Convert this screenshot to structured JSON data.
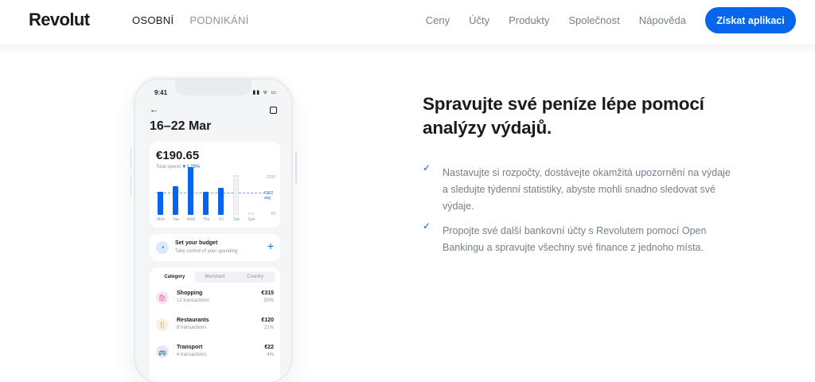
{
  "nav": {
    "logo": "Revolut",
    "left_items": [
      "OSOBNÍ",
      "PODNIKÁNÍ"
    ],
    "right_items": [
      "Ceny",
      "Účty",
      "Produkty",
      "Společnost",
      "Nápověda"
    ],
    "cta": "Získat aplikaci"
  },
  "phone": {
    "time": "9:41",
    "status_icons": "▮▮ ᯤ ▭",
    "back_icon": "arrow-left-icon",
    "date_range": "16–22 Mar",
    "spend": {
      "amount": "€190.65",
      "label": "Total spend",
      "change": "▼1.25%",
      "y_labels": [
        "€200",
        "€102 avg",
        "€0"
      ],
      "days": [
        "Mon",
        "Tue",
        "Wed",
        "Thu",
        "Fri",
        "Sat",
        "Sun"
      ],
      "values": [
        72,
        90,
        148,
        72,
        85,
        124,
        0
      ],
      "future": [
        false,
        false,
        false,
        false,
        false,
        true,
        true
      ]
    },
    "budget": {
      "title": "Set your budget",
      "subtitle": "Take control of your spending",
      "plus": "+"
    },
    "tabs": [
      "Category",
      "Merchant",
      "Country"
    ],
    "categories": [
      {
        "name": "Shopping",
        "sub": "12 transactions",
        "amount": "€315",
        "pct": "50%",
        "icon": "🛍",
        "icon_bg": "#fbe3f0",
        "icon_fg": "#e5489b"
      },
      {
        "name": "Restaurants",
        "sub": "8 transactions",
        "amount": "€120",
        "pct": "21%",
        "icon": "🍴",
        "icon_bg": "#fdf0dc",
        "icon_fg": "#e8a53a"
      },
      {
        "name": "Transport",
        "sub": "4 transactions",
        "amount": "€22",
        "pct": "4%",
        "icon": "🚌",
        "icon_bg": "#e3e8fb",
        "icon_fg": "#4a62d8"
      }
    ]
  },
  "content": {
    "headline": "Spravujte své peníze lépe pomocí analýzy výdajů.",
    "bullets": [
      "Nastavujte si rozpočty, dostávejte okamžitá upozornění na výdaje a sledujte týdenní statistiky, abyste mohli snadno sledovat své výdaje.",
      "Propojte své další bankovní účty s Revolutem pomocí Open Bankingu a spravujte všechny své finance z jednoho místa."
    ]
  },
  "colors": {
    "accent": "#0666eb",
    "text": "#191c1f",
    "muted": "#75808a"
  }
}
